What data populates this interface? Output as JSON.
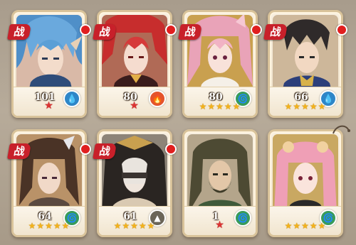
{
  "badge_text": "战",
  "colors": {
    "star_gold": "#f3b21b",
    "star_red": "#dd3333",
    "notification_dot": "#e01f1f",
    "badge": "#c8202a"
  },
  "heroes": [
    {
      "level": "101",
      "element": "water-drop-icon",
      "element_glyph": "💧",
      "stars": "★",
      "star_style": "red",
      "badge": true,
      "dot": true
    },
    {
      "level": "80",
      "element": "fire-icon",
      "element_glyph": "🔥",
      "stars": "★",
      "star_style": "red",
      "badge": true,
      "dot": true
    },
    {
      "level": "80",
      "element": "wind-icon",
      "element_glyph": "🌀",
      "stars": "★★★★★",
      "star_style": "gold",
      "badge": true,
      "dot": true
    },
    {
      "level": "66",
      "element": "water-drop-icon",
      "element_glyph": "💧",
      "stars": "★★★★★",
      "star_style": "gold",
      "badge": true,
      "dot": true
    },
    {
      "level": "64",
      "element": "wind-icon",
      "element_glyph": "🌀",
      "stars": "★★★★★",
      "star_style": "gold",
      "badge": true,
      "dot": true
    },
    {
      "level": "61",
      "element": "earth-icon",
      "element_glyph": "▲",
      "stars": "★★★★★",
      "star_style": "gold",
      "badge": true,
      "dot": true
    },
    {
      "level": "1",
      "element": "wind-icon",
      "element_glyph": "🌀",
      "stars": "★",
      "star_style": "red",
      "badge": false,
      "dot": false
    },
    {
      "level": "",
      "element": "wind-icon",
      "element_glyph": "🌀",
      "stars": "★★★★★",
      "star_style": "gold",
      "badge": false,
      "dot": false
    }
  ]
}
